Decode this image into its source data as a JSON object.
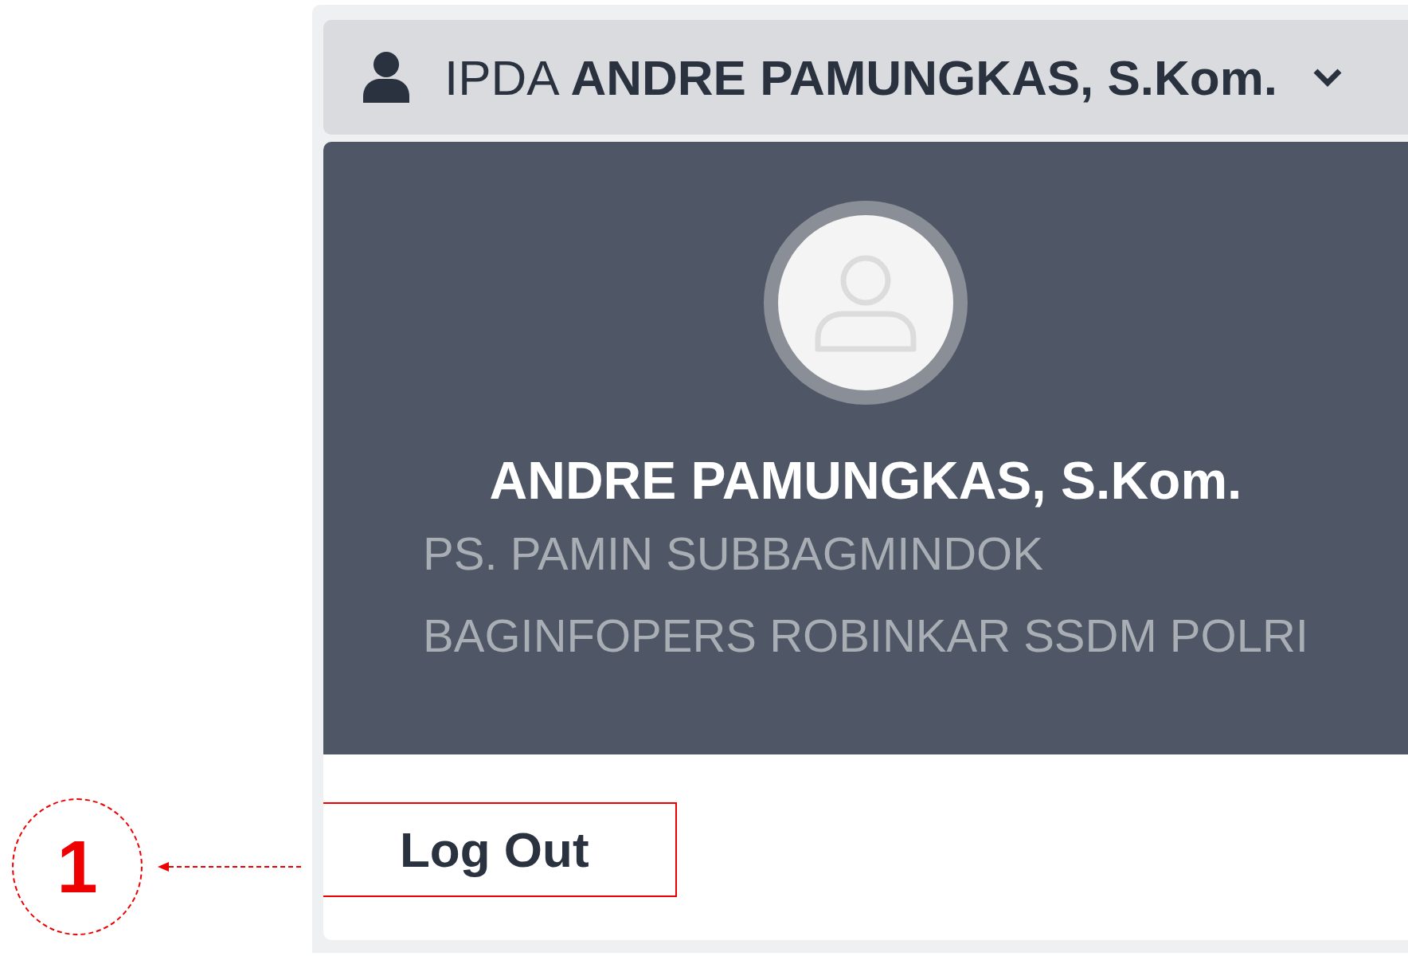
{
  "user_menu": {
    "label": "IPDA **ANDRE PAMUNGKAS, S.Kom.**",
    "expanded": true
  },
  "profile": {
    "name": "ANDRE PAMUNGKAS, S.Kom.",
    "position_lines": [
      "PS. PAMIN SUBBAGMINDOK",
      "BAGINFOPERS ROBINKAR SSDM POLRI"
    ]
  },
  "logout": {
    "label": "Log Out"
  },
  "annotation": {
    "number": "1"
  }
}
